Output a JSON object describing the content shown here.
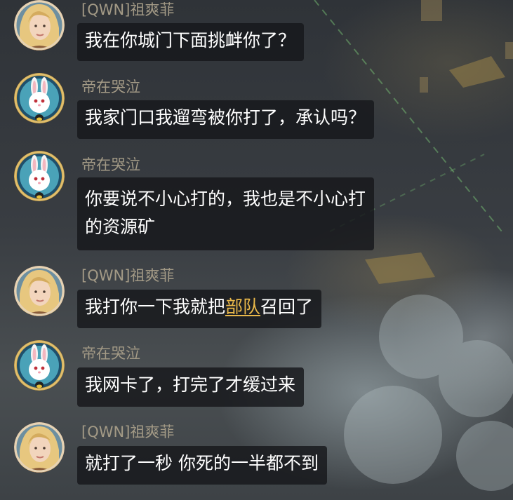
{
  "colors": {
    "sender_name": "#a39a86",
    "message_text": "#ffffff",
    "bubble_bg": "#16171b",
    "link": "#e9b84a",
    "avatar_ring_gold": "#c9a14a",
    "avatar_ring_blue": "#1f4f6b"
  },
  "users": {
    "qwn": {
      "name": "[QWN]祖爽菲",
      "avatar_icon": "blonde-woman-avatar-icon"
    },
    "di": {
      "name": "帝在哭泣",
      "avatar_icon": "white-rabbit-avatar-icon"
    }
  },
  "messages": [
    {
      "sender": "[QWN]祖爽菲",
      "lines": [
        "我在你城门下面挑衅你了？"
      ]
    },
    {
      "sender": "帝在哭泣",
      "lines": [
        "我家门口我遛弯被你打了，承认吗？"
      ]
    },
    {
      "sender": "帝在哭泣",
      "lines": [
        "你要说不小心打的，我也是不小心打",
        "的资源矿"
      ]
    },
    {
      "sender": "[QWN]祖爽菲",
      "text_before": "我打你一下我就把",
      "link_text": "部队",
      "text_after": "召回了"
    },
    {
      "sender": "帝在哭泣",
      "lines": [
        "我网卡了，打完了才缓过来"
      ]
    },
    {
      "sender": "[QWN]祖爽菲",
      "lines": [
        "就打了一秒 你死的一半都不到"
      ]
    }
  ]
}
